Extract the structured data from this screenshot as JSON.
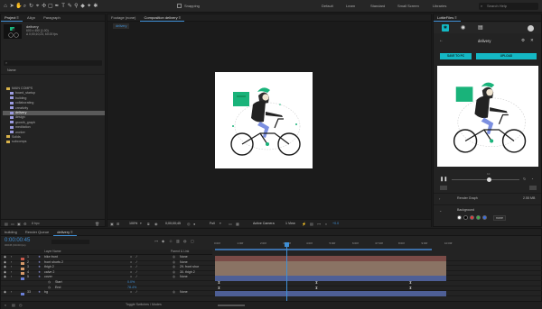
{
  "toolbar": {
    "snapping": "Snapping",
    "workspaces": [
      "Default",
      "Learn",
      "Standard",
      "Small Screen",
      "Libraries"
    ],
    "search_placeholder": "Search Help"
  },
  "project": {
    "tabs": [
      "Project ≡",
      "Align",
      "Paragraph"
    ],
    "comp_name": "delivery",
    "comp_info": [
      "600 x 450 (1.00)",
      "Δ 0;00;10;23, 60.00 fps"
    ],
    "search_placeholder": "",
    "col_name": "Name",
    "items": [
      {
        "type": "folder",
        "label": "MAIN COMPS",
        "indent": 0
      },
      {
        "type": "comp",
        "label": "board_startup",
        "indent": 1
      },
      {
        "type": "comp",
        "label": "building",
        "indent": 1
      },
      {
        "type": "comp",
        "label": "collaborating",
        "indent": 1
      },
      {
        "type": "comp",
        "label": "creativity",
        "indent": 1
      },
      {
        "type": "comp",
        "label": "delivery",
        "indent": 1,
        "selected": true
      },
      {
        "type": "comp",
        "label": "design",
        "indent": 1
      },
      {
        "type": "comp",
        "label": "growth_graph",
        "indent": 1
      },
      {
        "type": "comp",
        "label": "meditation",
        "indent": 1
      },
      {
        "type": "comp",
        "label": "worker",
        "indent": 1
      },
      {
        "type": "folder",
        "label": "Solids",
        "indent": 0
      },
      {
        "type": "folder",
        "label": "subcomps",
        "indent": 0
      }
    ],
    "bpc": "8 bpc"
  },
  "viewer": {
    "tabs": [
      "Footage (none)",
      "Composition delivery ≡"
    ],
    "comp_tab": "delivery",
    "zoom": "100%",
    "timecode": "0;00;00;45",
    "resolution": "Full",
    "camera": "Active Camera",
    "view": "1 View",
    "exposure": "+0.0"
  },
  "lottie": {
    "title": "LottieFiles ≡",
    "anim_name": "delivery",
    "save_label": "SAVE TO PC",
    "upload_label": "UPLOAD",
    "frame": "10",
    "render_graph_label": "Render Graph",
    "file_size": "2.55 MB",
    "background_label": "Background",
    "swatches": [
      "#ffffff",
      "#000000",
      "#e23b3b",
      "#3bb34a",
      "#3b6de2"
    ],
    "none_label": "none"
  },
  "timeline": {
    "tabs": [
      "building",
      "Render Queue",
      "delivery ≡"
    ],
    "timecode": "0:00:00:45",
    "subcode": "00045 (60.00 fps)",
    "col_layer": "Layer Name",
    "col_parent": "Parent & Link",
    "ruler": [
      "0:00f",
      "1:00f",
      "2:00f",
      "03:00f",
      "4:00f",
      "5:00f",
      "6:00f",
      "07:00f",
      "8:00f",
      "9:00f",
      "10:00f"
    ],
    "layers": [
      {
        "num": "1",
        "name": "bike front",
        "parent": "None",
        "color": "#c8574a",
        "bar": "#7a4b47"
      },
      {
        "num": "2",
        "name": "front shorts 2",
        "parent": "None",
        "color": "#d69a6a",
        "bar": "#8a7364"
      },
      {
        "num": "3",
        "name": "thigh 2",
        "parent": "29. front shor",
        "color": "#d69a6a",
        "bar": "#8a7364"
      },
      {
        "num": "4",
        "name": "calve 2",
        "parent": "30. thigh 2",
        "color": "#d69a6a",
        "bar": "#8a7364"
      },
      {
        "num": "5",
        "name": "cover",
        "parent": "None",
        "color": "#6a7fd6",
        "bar": "#4e5f96"
      }
    ],
    "props": [
      {
        "name": "Start",
        "value": "0.0%"
      },
      {
        "name": "End",
        "value": "78.4%"
      }
    ],
    "last_layer": {
      "num": "33",
      "name": "bg",
      "parent": "None",
      "color": "#6a7fd6",
      "bar": "#4e5f96"
    },
    "toggle_label": "Toggle Switches / Modes"
  }
}
